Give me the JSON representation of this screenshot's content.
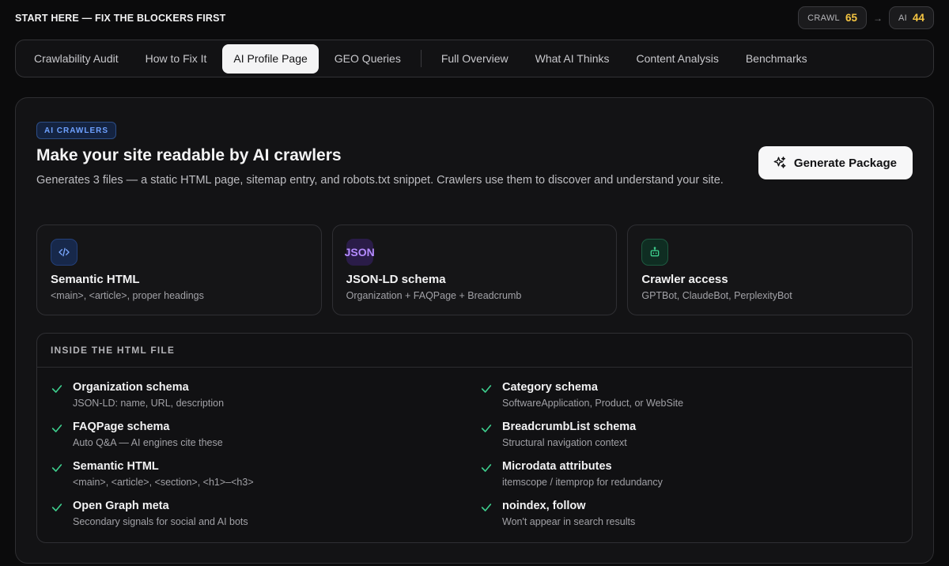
{
  "topbar": {
    "title": "START HERE — FIX THE BLOCKERS FIRST",
    "crawl_label": "CRAWL",
    "crawl_score": "65",
    "arrow": "→",
    "ai_label": "AI",
    "ai_score": "44"
  },
  "tabs": [
    {
      "label": "Crawlability Audit"
    },
    {
      "label": "How to Fix It"
    },
    {
      "label": "AI Profile Page",
      "active": true
    },
    {
      "label": "GEO Queries"
    },
    {
      "label": "Full Overview"
    },
    {
      "label": "What AI Thinks"
    },
    {
      "label": "Content Analysis"
    },
    {
      "label": "Benchmarks"
    }
  ],
  "hero": {
    "badge": "AI CRAWLERS",
    "title": "Make your site readable by AI crawlers",
    "description": "Generates 3 files — a static HTML page, sitemap entry, and robots.txt snippet. Crawlers use them to discover and understand your site.",
    "button_label": "Generate Package"
  },
  "features": [
    {
      "icon": "code-icon",
      "title": "Semantic HTML",
      "subtitle": "<main>, <article>, proper headings"
    },
    {
      "icon": "json-icon",
      "icon_text": "JSON",
      "title": "JSON-LD schema",
      "subtitle": "Organization + FAQPage + Breadcrumb"
    },
    {
      "icon": "bot-icon",
      "title": "Crawler access",
      "subtitle": "GPTBot, ClaudeBot, PerplexityBot"
    }
  ],
  "inside": {
    "heading": "INSIDE THE HTML FILE",
    "items": [
      {
        "title": "Organization schema",
        "subtitle": "JSON-LD: name, URL, description"
      },
      {
        "title": "Category schema",
        "subtitle": "SoftwareApplication, Product, or WebSite"
      },
      {
        "title": "FAQPage schema",
        "subtitle": "Auto Q&A — AI engines cite these"
      },
      {
        "title": "BreadcrumbList schema",
        "subtitle": "Structural navigation context"
      },
      {
        "title": "Semantic HTML",
        "subtitle": "<main>, <article>, <section>, <h1>–<h3>"
      },
      {
        "title": "Microdata attributes",
        "subtitle": "itemscope / itemprop for redundancy"
      },
      {
        "title": "Open Graph meta",
        "subtitle": "Secondary signals for social and AI bots"
      },
      {
        "title": "noindex, follow",
        "subtitle": "Won't appear in search results"
      }
    ]
  },
  "colors": {
    "accent_score": "#f5c542",
    "check": "#3ecf8e",
    "badge_blue": "#6ea1ff"
  }
}
